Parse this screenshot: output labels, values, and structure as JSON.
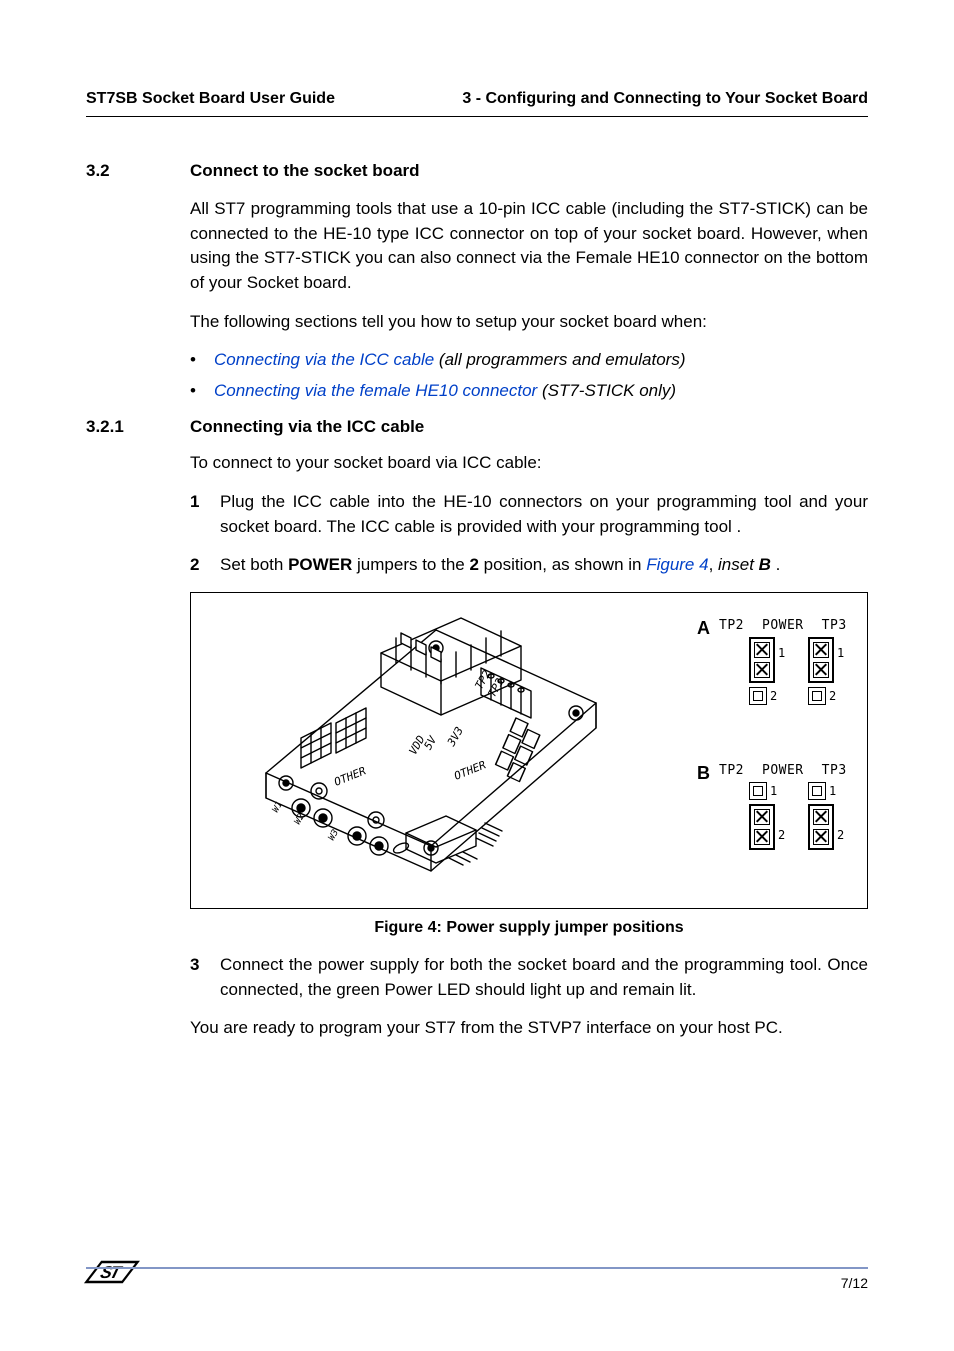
{
  "header": {
    "left": "ST7SB Socket Board User Guide",
    "right": "3 - Configuring and Connecting to Your Socket Board"
  },
  "section": {
    "number": "3.2",
    "title": "Connect to the socket board"
  },
  "para1": "All ST7 programming tools that use a 10-pin ICC cable (including the ST7-STICK) can be connected to the HE-10 type ICC connector on top of your socket board. However, when using the ST7-STICK you can also connect via the Female HE10 connector on the bottom of your Socket board.",
  "para2": "The following sections tell you how to setup your socket board when:",
  "bullets": [
    {
      "link": "Connecting via the ICC cable",
      "rest": " (all programmers and emulators)"
    },
    {
      "link": "Connecting via the female HE10 connector",
      "rest": " (ST7-STICK only)"
    }
  ],
  "subsection": {
    "number": "3.2.1",
    "title": "Connecting via the ICC cable"
  },
  "sub_intro": "To connect to your socket board via ICC cable:",
  "steps": {
    "s1": {
      "num": "1",
      "text": "Plug the ICC cable into the HE-10 connectors on your programming tool  and your socket board. The ICC cable is provided with your programming tool ."
    },
    "s2": {
      "num": "2",
      "text_pre": "Set both ",
      "bold1": "POWER",
      "text_mid1": " jumpers to the ",
      "bold2": "2",
      "text_mid2": " position, as shown in ",
      "link": "Figure 4",
      "text_mid3": ", ",
      "italic1": "inset ",
      "bolditalic": "B",
      "text_end": " ."
    },
    "s3": {
      "num": "3",
      "text": "Connect the power supply for both the socket board and the programming tool. Once connected, the green Power LED should light up and remain lit."
    }
  },
  "figure": {
    "caption": "Figure 4: Power supply jumper positions",
    "inset_a_label": "A",
    "inset_b_label": "B",
    "power_text": "POWER",
    "tp2": "TP2",
    "tp3": "TP3",
    "pin1": "1",
    "pin2": "2",
    "board_labels": {
      "other1": "OTHER",
      "other2": "OTHER",
      "vdd": "VDD",
      "v5": "5V",
      "v3": "3V3",
      "tp3r": "TP3",
      "tp2r": "TP2",
      "w1": "W1",
      "w2": "W2",
      "w3": "W3"
    }
  },
  "closing": "You are ready to program your ST7 from the STVP7 interface on your host PC.",
  "footer": {
    "pagenum": "7/12",
    "logo": "ST"
  }
}
